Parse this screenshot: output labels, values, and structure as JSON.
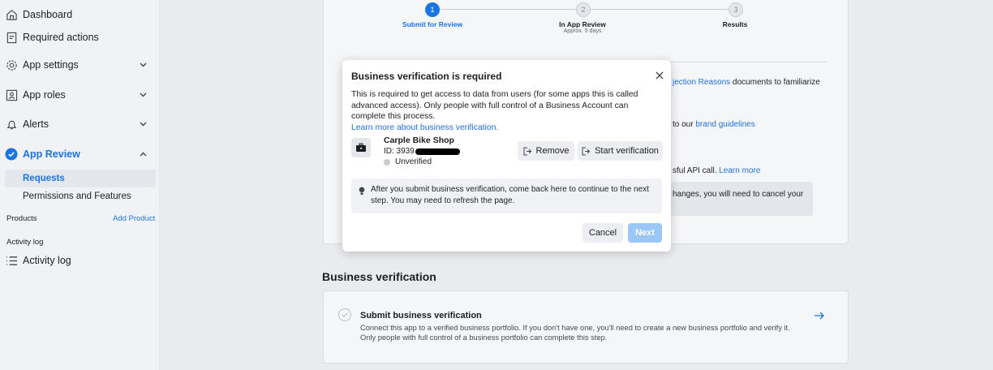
{
  "sidebar": {
    "dashboard": "Dashboard",
    "required_actions": "Required actions",
    "app_settings": "App settings",
    "app_roles": "App roles",
    "alerts": "Alerts",
    "app_review": "App Review",
    "requests": "Requests",
    "permissions": "Permissions and Features",
    "products_label": "Products",
    "add_product": "Add Product",
    "activity_log_small": "Activity log",
    "activity_log": "Activity log"
  },
  "stepper": {
    "steps": [
      {
        "label": "Submit for Review",
        "number": "1",
        "sub": ""
      },
      {
        "label": "In App Review",
        "number": "2",
        "sub": "Approx. 5 days"
      },
      {
        "label": "Results",
        "number": "3",
        "sub": ""
      }
    ]
  },
  "background_card": {
    "line1_prefix": "jection Reasons",
    "line1_suffix": " documents to familiarize",
    "line2_prefix": "to our ",
    "line2_link": "brand guidelines",
    "line3_prefix": "sful API call. ",
    "line3_link": "Learn more",
    "notice": "hanges, you will need to cancel your"
  },
  "business_verification": {
    "heading": "Business verification",
    "title": "Submit business verification",
    "desc_line1": "Connect this app to a verified business portfolio. If you don't have one, you'll need to create a new business portfolio and verify it.",
    "desc_line2": "Only people with full control of a business portfolio can complete this step."
  },
  "modal": {
    "title": "Business verification is required",
    "body": "This is required to get access to data from users (for some apps this is called advanced access). Only people with full control of a Business Account can complete this process.",
    "link": "Learn more about business verification.",
    "business_name": "Carple Bike Shop",
    "business_id_prefix": "ID: 3939",
    "status": "Unverified",
    "remove": "Remove",
    "start": "Start verification",
    "info": "After you submit business verification, come back here to continue to the next step. You may need to refresh the page.",
    "cancel": "Cancel",
    "next": "Next"
  },
  "colors": {
    "accent": "#1b74e4",
    "link": "#216fdb",
    "next_disabled": "#9cc6f5",
    "unverified_dot": "#c8ccd1"
  }
}
